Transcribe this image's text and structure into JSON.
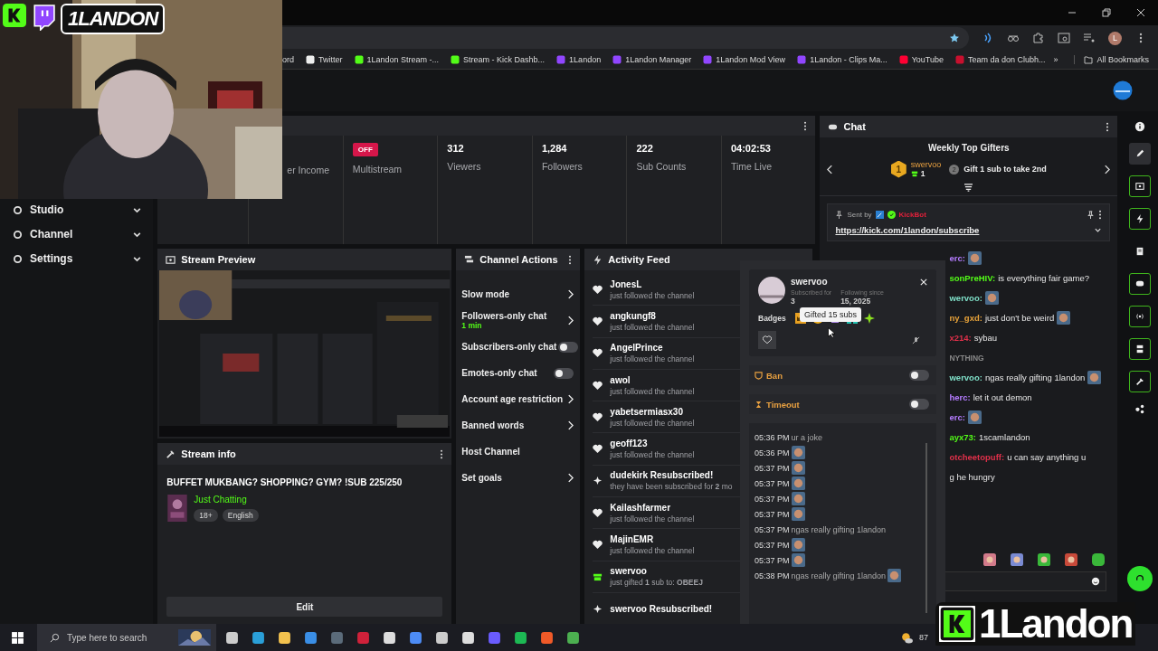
{
  "stream_overlay": {
    "top_text": "1LANDON",
    "bottom_text": "1Landon"
  },
  "browser": {
    "bookmarks": [
      {
        "label": "ord",
        "kind": "plain"
      },
      {
        "label": "Twitter",
        "kind": "x"
      },
      {
        "label": "1Landon Stream -...",
        "kind": "kick"
      },
      {
        "label": "Stream - Kick Dashb...",
        "kind": "kick"
      },
      {
        "label": "1Landon",
        "kind": "twitch"
      },
      {
        "label": "1Landon Manager",
        "kind": "twitch"
      },
      {
        "label": "1Landon Mod View",
        "kind": "twitch"
      },
      {
        "label": "1Landon - Clips Ma...",
        "kind": "twitch"
      },
      {
        "label": "YouTube",
        "kind": "youtube"
      },
      {
        "label": "Team da don Clubh...",
        "kind": "red"
      }
    ],
    "more": "»",
    "all_bookmarks": "All Bookmarks",
    "profile_initial": "L"
  },
  "sidebar": {
    "items": [
      {
        "label": "Studio"
      },
      {
        "label": "Channel"
      },
      {
        "label": "Settings"
      }
    ]
  },
  "stats": [
    {
      "label": "er Income"
    },
    {
      "badge": "OFF",
      "label": "Multistream"
    },
    {
      "value": "312",
      "label": "Viewers"
    },
    {
      "value": "1,284",
      "label": "Followers"
    },
    {
      "value": "222",
      "label": "Sub Counts"
    },
    {
      "value": "04:02:53",
      "label": "Time Live"
    }
  ],
  "stream_preview": {
    "title": "Stream Preview"
  },
  "stream_info": {
    "title": "Stream info",
    "stream_title": "BUFFET MUKBANG? SHOPPING? GYM? !SUB 225/250",
    "category": "Just Chatting",
    "tags": [
      "18+",
      "English"
    ],
    "edit_button": "Edit"
  },
  "channel_actions": {
    "title": "Channel Actions",
    "items": [
      {
        "kind": "link",
        "label": "Slow mode"
      },
      {
        "kind": "link",
        "label": "Followers-only chat",
        "detail": "1 min"
      },
      {
        "kind": "toggle",
        "label": "Subscribers-only chat",
        "on": false
      },
      {
        "kind": "toggle",
        "label": "Emotes-only chat",
        "on": false
      },
      {
        "kind": "link",
        "label": "Account age restriction"
      },
      {
        "kind": "link",
        "label": "Banned words"
      },
      {
        "kind": "plain",
        "label": "Host Channel"
      },
      {
        "kind": "link",
        "label": "Set goals"
      }
    ]
  },
  "activity_feed": {
    "title": "Activity Feed",
    "items": [
      {
        "kind": "follow",
        "name": "JonesL",
        "detail": "just followed the channel"
      },
      {
        "kind": "follow",
        "name": "angkungf8",
        "detail": "just followed the channel"
      },
      {
        "kind": "follow",
        "name": "AngelPrince",
        "detail": "just followed the channel"
      },
      {
        "kind": "follow",
        "name": "awol",
        "detail": "just followed the channel"
      },
      {
        "kind": "follow",
        "name": "yabetsermiasx30",
        "detail": "just followed the channel"
      },
      {
        "kind": "follow",
        "name": "geoff123",
        "detail": "just followed the channel"
      },
      {
        "kind": "resub",
        "name": "dudekirk Resubscribed!",
        "detail": "they have been subscribed for **2** mo"
      },
      {
        "kind": "follow",
        "name": "Kailashfarmer",
        "detail": "just followed the channel"
      },
      {
        "kind": "follow",
        "name": "MajinEMR",
        "detail": "just followed the channel"
      },
      {
        "kind": "gift",
        "name": "swervoo",
        "detail": "just gifted **1** sub to: **OBEEJ**"
      },
      {
        "kind": "resub",
        "name": "swervoo Resubscribed!"
      }
    ]
  },
  "chat": {
    "title": "Chat",
    "top_gifters": {
      "title": "Weekly Top Gifters",
      "rank": "1",
      "name": "swervoo",
      "count": "1",
      "next_rank": "2",
      "goal": "Gift 1 sub to take 2nd"
    },
    "pinned": {
      "sent_by": "Sent by",
      "author": "KickBot",
      "link": "https://kick.com/1landon/subscribe"
    },
    "messages": [
      {
        "kind": "message",
        "user": "erc:",
        "color": "#b57cff",
        "emote": true
      },
      {
        "kind": "message",
        "user": "sonPreHIV:",
        "color": "#53fc18",
        "text": "is everything fair game?",
        "emote": false
      },
      {
        "kind": "message",
        "user": "wervoo:",
        "color": "#7fe0c8",
        "emote": true
      },
      {
        "kind": "message",
        "user": "ny_gxd:",
        "color": "#e8a33a",
        "text": "just don't be weird",
        "emote": true
      },
      {
        "kind": "message",
        "user": "x214:",
        "color": "#e0304a",
        "text": "sybau",
        "emote": false
      },
      {
        "kind": "notice",
        "text": "NYTHING"
      },
      {
        "kind": "message",
        "user": "wervoo:",
        "color": "#7fe0c8",
        "text": "ngas really gifting 1landon",
        "emote": true
      },
      {
        "kind": "message",
        "user": "herc:",
        "color": "#b57cff",
        "text": "let it out demon",
        "emote": false
      },
      {
        "kind": "message",
        "user": "erc:",
        "color": "#b57cff",
        "emote": true
      },
      {
        "kind": "message",
        "user": "ayx73:",
        "color": "#53fc18",
        "text": "1scamlandon",
        "emote": false
      },
      {
        "kind": "message",
        "user": "otcheetopuff:",
        "color": "#e0304a",
        "text": "u can say anything u",
        "emote": false
      },
      {
        "kind": "continuation",
        "text": "g he hungry"
      }
    ]
  },
  "user_card": {
    "username": "swervoo",
    "subscribed_label": "Subscribed for",
    "subscribed_value": "3",
    "following_label": "Following since",
    "following_value": "15, 2025",
    "tooltip": "Gifted 15 subs",
    "badges_label": "Badges",
    "ban_label": "Ban",
    "ban_on": false,
    "timeout_label": "Timeout",
    "timeout_on": false,
    "history": [
      {
        "time": "05:36 PM",
        "text": "ur a joke",
        "emote": false
      },
      {
        "time": "05:36 PM",
        "emote": true
      },
      {
        "time": "05:37 PM",
        "emote": true
      },
      {
        "time": "05:37 PM",
        "emote": true
      },
      {
        "time": "05:37 PM",
        "emote": true
      },
      {
        "time": "05:37 PM",
        "emote": true
      },
      {
        "time": "05:37 PM",
        "text": "ngas really gifting 1landon",
        "emote": false
      },
      {
        "time": "05:37 PM",
        "emote": true
      },
      {
        "time": "05:37 PM",
        "emote": true
      },
      {
        "time": "05:38 PM",
        "text": "ngas really gifting 1landon",
        "emote": true
      }
    ]
  },
  "taskbar": {
    "search_placeholder": "Type here to search",
    "weather": "87"
  }
}
